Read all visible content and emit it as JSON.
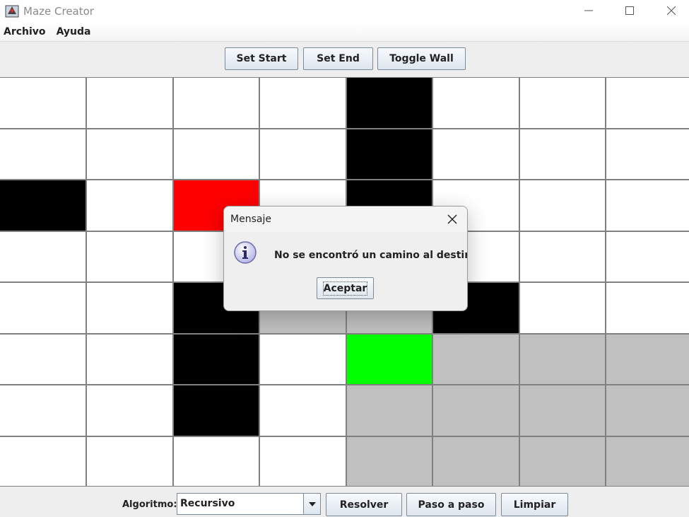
{
  "window": {
    "title": "Maze Creator",
    "icon": "maze-app-icon"
  },
  "menu": [
    {
      "label": "Archivo"
    },
    {
      "label": "Ayuda"
    }
  ],
  "toolbar": {
    "set_start": "Set Start",
    "set_end": "Set End",
    "toggle_wall": "Toggle Wall"
  },
  "maze": {
    "rows": 8,
    "cols": 8,
    "colors": {
      "empty": "#ffffff",
      "wall": "#000000",
      "start": "#ff0000",
      "end": "#00ff00",
      "visited": "#c0c0c0",
      "grid": "#808080"
    },
    "cells": [
      [
        "empty",
        "empty",
        "empty",
        "empty",
        "wall",
        "empty",
        "empty",
        "empty"
      ],
      [
        "empty",
        "empty",
        "empty",
        "empty",
        "wall",
        "empty",
        "empty",
        "empty"
      ],
      [
        "wall",
        "empty",
        "start",
        "empty",
        "wall",
        "empty",
        "empty",
        "empty"
      ],
      [
        "empty",
        "empty",
        "empty",
        "empty",
        "empty",
        "empty",
        "empty",
        "empty"
      ],
      [
        "empty",
        "empty",
        "wall",
        "visited",
        "visited",
        "wall",
        "empty",
        "empty"
      ],
      [
        "empty",
        "empty",
        "wall",
        "empty",
        "end",
        "visited",
        "visited",
        "visited"
      ],
      [
        "empty",
        "empty",
        "wall",
        "empty",
        "visited",
        "visited",
        "visited",
        "visited"
      ],
      [
        "empty",
        "empty",
        "empty",
        "empty",
        "visited",
        "visited",
        "visited",
        "visited"
      ]
    ]
  },
  "bottom": {
    "algo_label": "Algoritmo:",
    "algo_selected": "Recursivo",
    "solve": "Resolver",
    "step": "Paso a paso",
    "clear": "Limpiar"
  },
  "dialog": {
    "title": "Mensaje",
    "message": "No se encontró un camino al destino.",
    "ok": "Aceptar",
    "icon": "info-icon"
  }
}
